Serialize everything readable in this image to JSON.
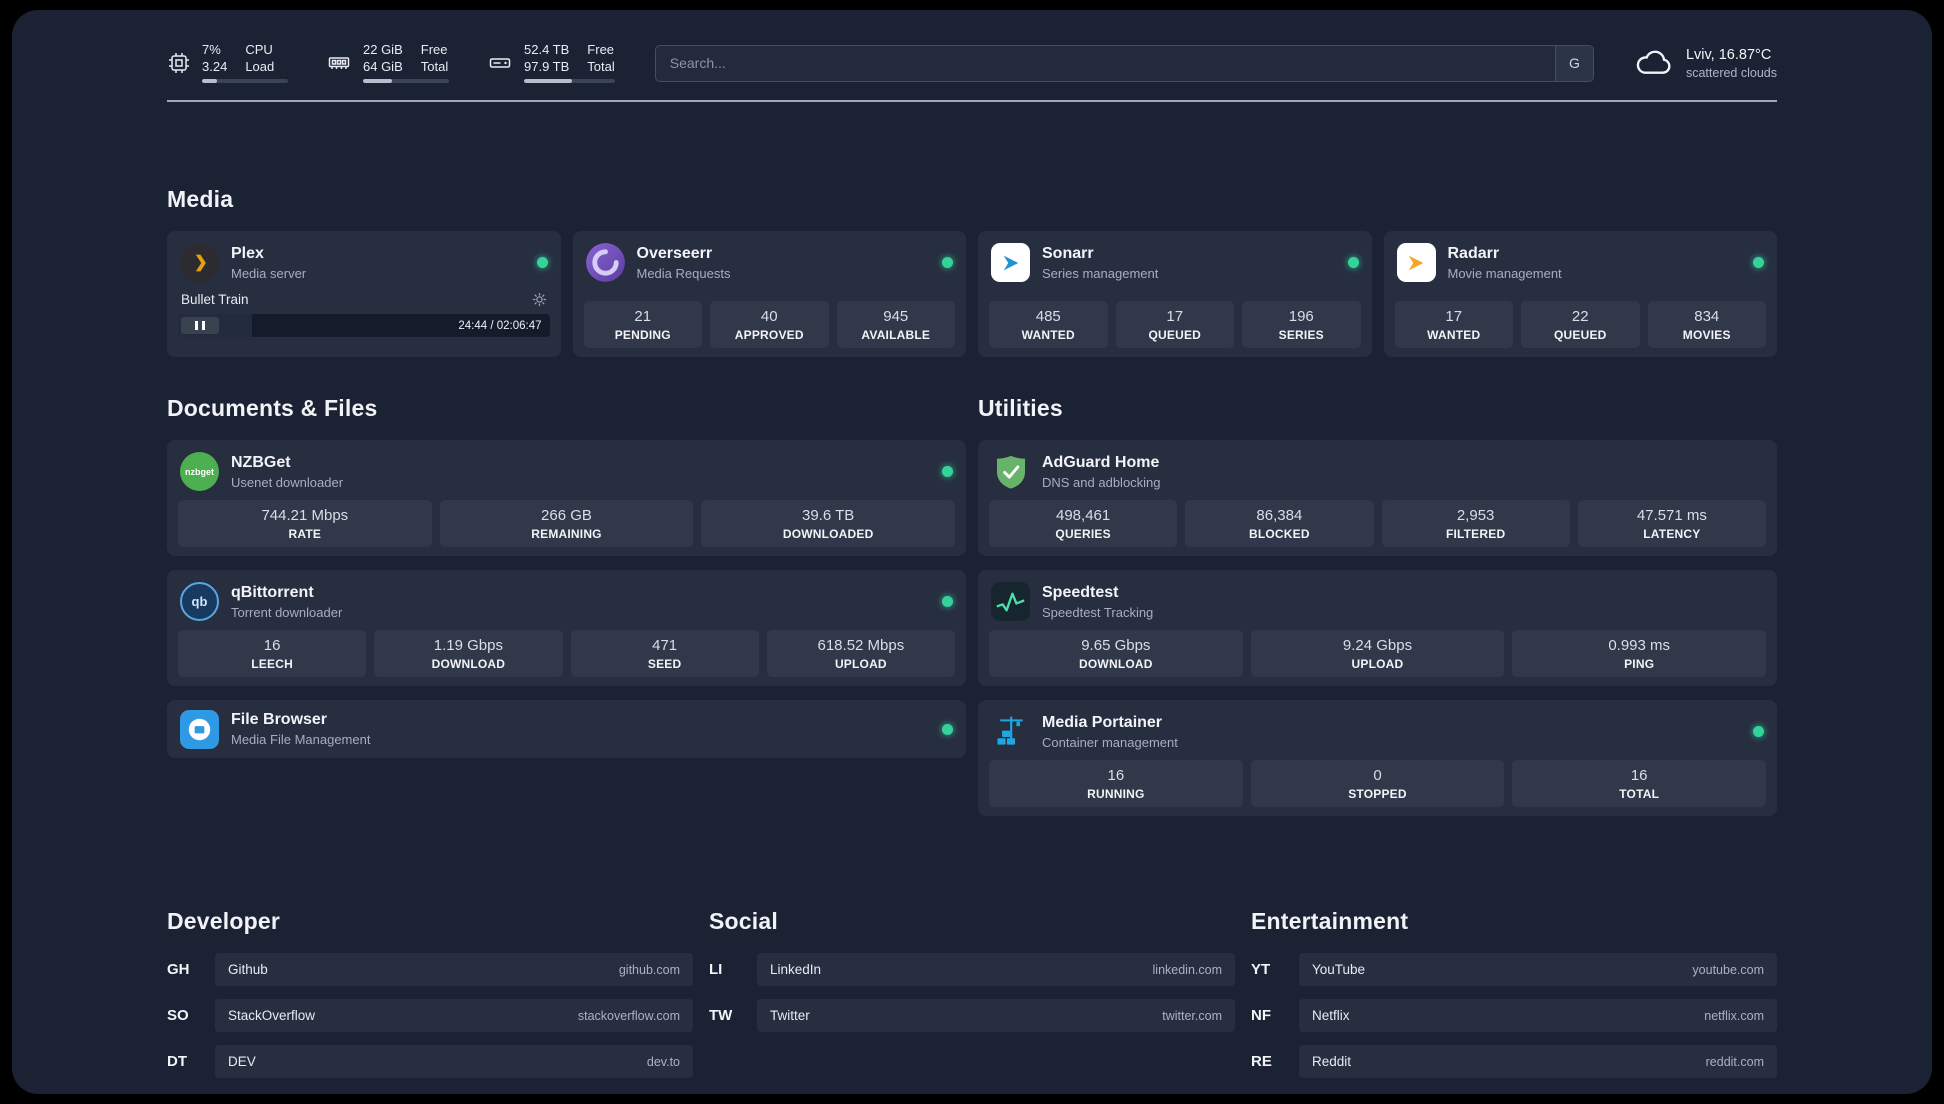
{
  "topbar": {
    "cpu": {
      "value_top": "7%",
      "value_bottom": "3.24",
      "label_top": "CPU",
      "label_bottom": "Load",
      "progress_pct": 18
    },
    "memory": {
      "value_top": "22 GiB",
      "value_bottom": "64 GiB",
      "label_top": "Free",
      "label_bottom": "Total",
      "progress_pct": 34
    },
    "disk": {
      "value_top": "52.4 TB",
      "value_bottom": "97.9 TB",
      "label_top": "Free",
      "label_bottom": "Total",
      "progress_pct": 53
    },
    "search": {
      "placeholder": "Search...",
      "button_label": "G"
    },
    "weather": {
      "location": "Lviv, 16.87°C",
      "condition": "scattered clouds"
    }
  },
  "media": {
    "title": "Media",
    "plex": {
      "name": "Plex",
      "description": "Media server",
      "now_playing": "Bullet Train",
      "time": "24:44 / 02:06:47",
      "progress_pct": 20
    },
    "overseerr": {
      "name": "Overseerr",
      "description": "Media Requests",
      "stats": [
        {
          "value": "21",
          "label": "PENDING"
        },
        {
          "value": "40",
          "label": "APPROVED"
        },
        {
          "value": "945",
          "label": "AVAILABLE"
        }
      ]
    },
    "sonarr": {
      "name": "Sonarr",
      "description": "Series management",
      "stats": [
        {
          "value": "485",
          "label": "WANTED"
        },
        {
          "value": "17",
          "label": "QUEUED"
        },
        {
          "value": "196",
          "label": "SERIES"
        }
      ]
    },
    "radarr": {
      "name": "Radarr",
      "description": "Movie management",
      "stats": [
        {
          "value": "17",
          "label": "WANTED"
        },
        {
          "value": "22",
          "label": "QUEUED"
        },
        {
          "value": "834",
          "label": "MOVIES"
        }
      ]
    }
  },
  "documents": {
    "title": "Documents & Files",
    "nzbget": {
      "name": "NZBGet",
      "description": "Usenet downloader",
      "icon_text": "nzbget",
      "stats": [
        {
          "value": "744.21 Mbps",
          "label": "RATE"
        },
        {
          "value": "266 GB",
          "label": "REMAINING"
        },
        {
          "value": "39.6 TB",
          "label": "DOWNLOADED"
        }
      ]
    },
    "qbittorrent": {
      "name": "qBittorrent",
      "description": "Torrent downloader",
      "icon_text": "qb",
      "stats": [
        {
          "value": "16",
          "label": "LEECH"
        },
        {
          "value": "1.19 Gbps",
          "label": "DOWNLOAD"
        },
        {
          "value": "471",
          "label": "SEED"
        },
        {
          "value": "618.52 Mbps",
          "label": "UPLOAD"
        }
      ]
    },
    "filebrowser": {
      "name": "File Browser",
      "description": "Media File Management"
    }
  },
  "utilities": {
    "title": "Utilities",
    "adguard": {
      "name": "AdGuard Home",
      "description": "DNS and adblocking",
      "stats": [
        {
          "value": "498,461",
          "label": "QUERIES"
        },
        {
          "value": "86,384",
          "label": "BLOCKED"
        },
        {
          "value": "2,953",
          "label": "FILTERED"
        },
        {
          "value": "47.571 ms",
          "label": "LATENCY"
        }
      ]
    },
    "speedtest": {
      "name": "Speedtest",
      "description": "Speedtest Tracking",
      "stats": [
        {
          "value": "9.65 Gbps",
          "label": "DOWNLOAD"
        },
        {
          "value": "9.24 Gbps",
          "label": "UPLOAD"
        },
        {
          "value": "0.993 ms",
          "label": "PING"
        }
      ]
    },
    "portainer": {
      "name": "Media Portainer",
      "description": "Container management",
      "stats": [
        {
          "value": "16",
          "label": "RUNNING"
        },
        {
          "value": "0",
          "label": "STOPPED"
        },
        {
          "value": "16",
          "label": "TOTAL"
        }
      ]
    }
  },
  "bookmarks": [
    {
      "title": "Developer",
      "links": [
        {
          "abbr": "GH",
          "name": "Github",
          "domain": "github.com"
        },
        {
          "abbr": "SO",
          "name": "StackOverflow",
          "domain": "stackoverflow.com"
        },
        {
          "abbr": "DT",
          "name": "DEV",
          "domain": "dev.to"
        }
      ]
    },
    {
      "title": "Social",
      "links": [
        {
          "abbr": "LI",
          "name": "LinkedIn",
          "domain": "linkedin.com"
        },
        {
          "abbr": "TW",
          "name": "Twitter",
          "domain": "twitter.com"
        }
      ]
    },
    {
      "title": "Entertainment",
      "links": [
        {
          "abbr": "YT",
          "name": "YouTube",
          "domain": "youtube.com"
        },
        {
          "abbr": "NF",
          "name": "Netflix",
          "domain": "netflix.com"
        },
        {
          "abbr": "RE",
          "name": "Reddit",
          "domain": "reddit.com"
        }
      ]
    }
  ],
  "colors": {
    "status_online": "#34d399",
    "plex_accent": "#e5a00d",
    "sonarr_accent": "#2193d1",
    "radarr_accent": "#f5a623",
    "adguard_accent": "#67b36a",
    "portainer_accent": "#1ea7e1",
    "speedtest_accent": "#4ce0a6",
    "filebrowser_accent": "#2f9ae3",
    "nzbget_accent": "#4caf50",
    "overseerr_accent": "#6d4aae"
  }
}
